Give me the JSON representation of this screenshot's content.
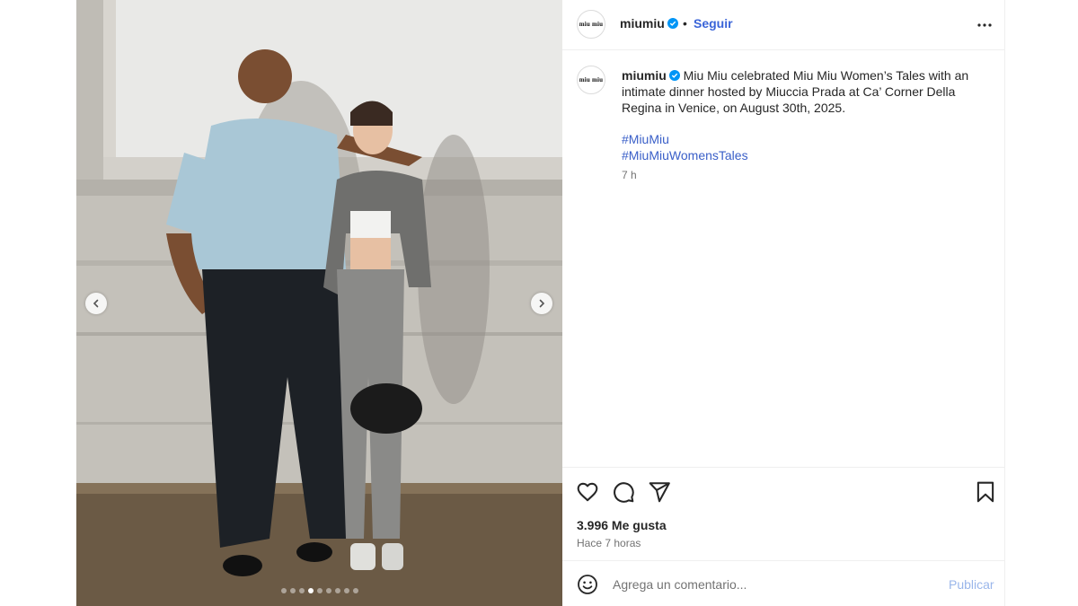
{
  "post": {
    "username": "miumiu",
    "avatar_text": "miu miu",
    "follow_label": "Seguir",
    "bullet": "•",
    "caption": "Miu Miu celebrated Miu Miu Women’s Tales with an intimate dinner hosted by Miuccia Prada at Ca’ Corner Della Regina in Venice, on August 30th, 2025.",
    "hashtags": [
      "#MiuMiu",
      "#MiuMiuWomensTales"
    ],
    "caption_time": "7 h",
    "likes": "3.996 Me gusta",
    "posted_ago": "Hace 7 horas"
  },
  "comment": {
    "placeholder": "Agrega un comentario...",
    "publish_label": "Publicar"
  },
  "carousel": {
    "total_slides": 9,
    "current_index": 3
  },
  "icons": [
    "verified-badge-icon",
    "more-options-icon",
    "heart-icon",
    "comment-icon",
    "share-icon",
    "bookmark-icon",
    "emoji-icon",
    "chevron-left-icon",
    "chevron-right-icon"
  ],
  "colors": {
    "link": "#3a64d8",
    "hashtag": "#3a5fc8",
    "verified": "#0095f6",
    "publish_disabled": "#9ab6ea"
  }
}
